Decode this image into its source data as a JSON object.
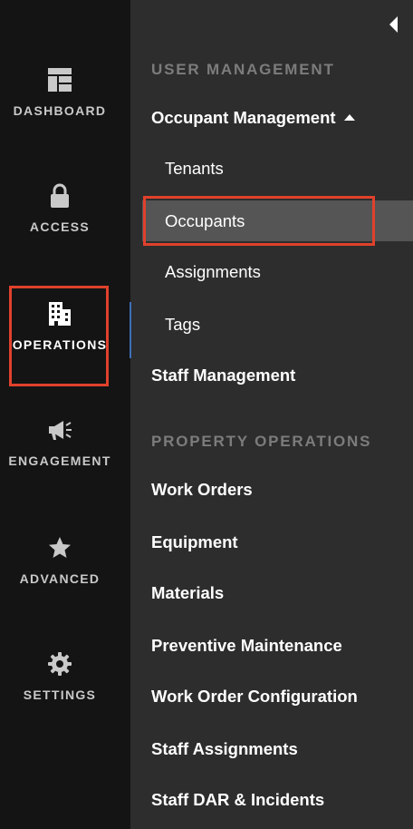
{
  "rail": {
    "items": [
      {
        "label": "DASHBOARD",
        "icon": "dashboard-icon",
        "active": false
      },
      {
        "label": "ACCESS",
        "icon": "lock-icon",
        "active": false
      },
      {
        "label": "OPERATIONS",
        "icon": "building-icon",
        "active": true
      },
      {
        "label": "ENGAGEMENT",
        "icon": "megaphone-icon",
        "active": false
      },
      {
        "label": "ADVANCED",
        "icon": "star-icon",
        "active": false
      },
      {
        "label": "SETTINGS",
        "icon": "gear-icon",
        "active": false
      }
    ]
  },
  "panel": {
    "collapse_icon": "caret-left-icon",
    "sections": [
      {
        "title": "USER MANAGEMENT",
        "items": [
          {
            "label": "Occupant Management",
            "expanded": true,
            "children": [
              "Tenants",
              "Occupants",
              "Assignments",
              "Tags"
            ],
            "selected_child": "Occupants"
          },
          {
            "label": "Staff Management"
          }
        ]
      },
      {
        "title": "PROPERTY OPERATIONS",
        "items": [
          {
            "label": "Work Orders"
          },
          {
            "label": "Equipment"
          },
          {
            "label": "Materials"
          },
          {
            "label": "Preventive Maintenance"
          },
          {
            "label": "Work Order Configuration"
          },
          {
            "label": "Staff Assignments"
          },
          {
            "label": "Staff DAR & Incidents"
          }
        ]
      }
    ]
  },
  "colors": {
    "rail_bg": "#141414",
    "panel_bg": "#2d2d2d",
    "selected_bg": "#555555",
    "highlight_border": "#e0412c",
    "active_indicator": "#3f6fb6",
    "section_heading": "#7c7c7c"
  }
}
